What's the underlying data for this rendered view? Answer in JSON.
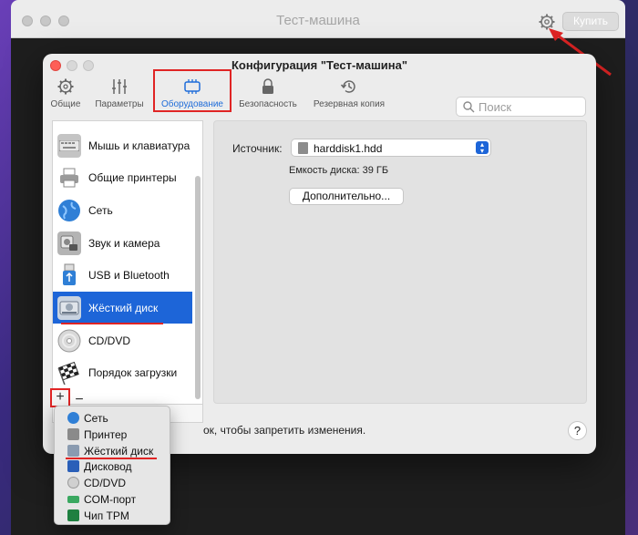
{
  "background_window": {
    "title": "Тест-машина",
    "run_label": "Купить"
  },
  "dialog": {
    "title": "Конфигурация \"Тест-машина\"",
    "toolbar": [
      {
        "label": "Общие",
        "icon": "gear-icon"
      },
      {
        "label": "Параметры",
        "icon": "sliders-icon"
      },
      {
        "label": "Оборудование",
        "icon": "hardware-chip-icon",
        "active": true
      },
      {
        "label": "Безопасность",
        "icon": "lock-icon"
      },
      {
        "label": "Резервная копия",
        "icon": "clock-history-icon"
      }
    ],
    "search_placeholder": "Поиск",
    "devices": [
      {
        "label": "Мышь и клавиатура",
        "icon": "keyboard-icon",
        "color": "#b8b8b8"
      },
      {
        "label": "Общие принтеры",
        "icon": "printer-icon",
        "color": "#9a9a9a"
      },
      {
        "label": "Сеть",
        "icon": "globe-icon",
        "color": "#2f7fd6"
      },
      {
        "label": "Звук и камера",
        "icon": "speaker-camera-icon",
        "color": "#a8a8a8"
      },
      {
        "label": "USB и Bluetooth",
        "icon": "usb-icon",
        "color": "#2f7fd6"
      },
      {
        "label": "Жёсткий диск",
        "icon": "hard-disk-icon",
        "color": "#8a9bb0",
        "selected": true
      },
      {
        "label": "CD/DVD",
        "icon": "cd-icon",
        "color": "#c8c8c8"
      },
      {
        "label": "Порядок загрузки",
        "icon": "checkered-flag-icon",
        "color": "#555555"
      }
    ],
    "add_label": "+",
    "remove_label": "−",
    "detail": {
      "source_label": "Источник:",
      "source_value": "harddisk1.hdd",
      "capacity": "Емкость диска: 39 ГБ",
      "advanced_button": "Дополнительно..."
    },
    "lock_text": "ок, чтобы запретить изменения.",
    "help_label": "?"
  },
  "add_menu": [
    {
      "label": "Сеть",
      "icon": "globe-icon",
      "color": "#2f7fd6"
    },
    {
      "label": "Принтер",
      "icon": "printer-icon",
      "color": "#8a8a8a"
    },
    {
      "label": "Жёсткий диск",
      "icon": "hard-disk-icon",
      "color": "#8a9bb0"
    },
    {
      "label": "Дисковод",
      "icon": "floppy-icon",
      "color": "#2a5fb8"
    },
    {
      "label": "CD/DVD",
      "icon": "cd-icon",
      "color": "#c0c0c0"
    },
    {
      "label": "COM-порт",
      "icon": "serial-port-icon",
      "color": "#3aa860"
    },
    {
      "label": "Чип TPM",
      "icon": "chip-icon",
      "color": "#1e8040"
    }
  ],
  "colors": {
    "accent": "#1d65d8",
    "annotation": "#e02424"
  }
}
